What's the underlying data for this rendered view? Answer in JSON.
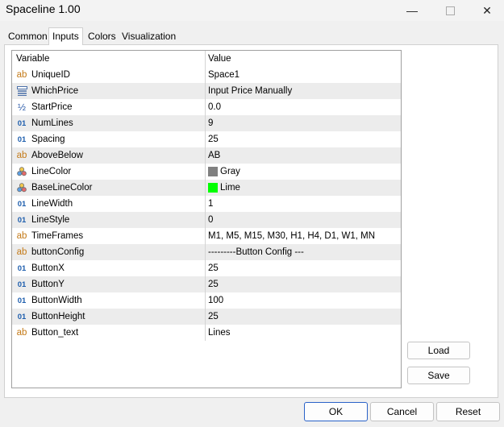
{
  "window": {
    "title": "Spaceline 1.00"
  },
  "tabs": [
    {
      "label": "Common"
    },
    {
      "label": "Inputs"
    },
    {
      "label": "Colors"
    },
    {
      "label": "Visualization"
    }
  ],
  "table": {
    "header": {
      "variable": "Variable",
      "value": "Value"
    },
    "rows": [
      {
        "icon": "ab",
        "name": "UniqueID",
        "value": "Space1"
      },
      {
        "icon": "list",
        "name": "WhichPrice",
        "value": "Input Price Manually"
      },
      {
        "icon": "half",
        "name": "StartPrice",
        "value": "0.0"
      },
      {
        "icon": "01",
        "name": "NumLines",
        "value": "9"
      },
      {
        "icon": "01",
        "name": "Spacing",
        "value": "25"
      },
      {
        "icon": "ab",
        "name": "AboveBelow",
        "value": "AB"
      },
      {
        "icon": "palette",
        "name": "LineColor",
        "value": "Gray",
        "swatch": "#808080"
      },
      {
        "icon": "palette",
        "name": "BaseLineColor",
        "value": "Lime",
        "swatch": "#00ff00"
      },
      {
        "icon": "01",
        "name": "LineWidth",
        "value": "1"
      },
      {
        "icon": "01",
        "name": "LineStyle",
        "value": "0"
      },
      {
        "icon": "ab",
        "name": "TimeFrames",
        "value": "M1, M5, M15, M30, H1, H4, D1, W1, MN"
      },
      {
        "icon": "ab",
        "name": "buttonConfig",
        "value": "---------Button Config ---"
      },
      {
        "icon": "01",
        "name": "ButtonX",
        "value": "25"
      },
      {
        "icon": "01",
        "name": "ButtonY",
        "value": "25"
      },
      {
        "icon": "01",
        "name": "ButtonWidth",
        "value": "100"
      },
      {
        "icon": "01",
        "name": "ButtonHeight",
        "value": "25"
      },
      {
        "icon": "ab",
        "name": "Button_text",
        "value": "Lines"
      }
    ]
  },
  "side_buttons": {
    "load": "Load",
    "save": "Save"
  },
  "footer": {
    "ok": "OK",
    "cancel": "Cancel",
    "reset": "Reset"
  },
  "icons": {
    "ab": "ab",
    "num": "01",
    "half": "½"
  }
}
